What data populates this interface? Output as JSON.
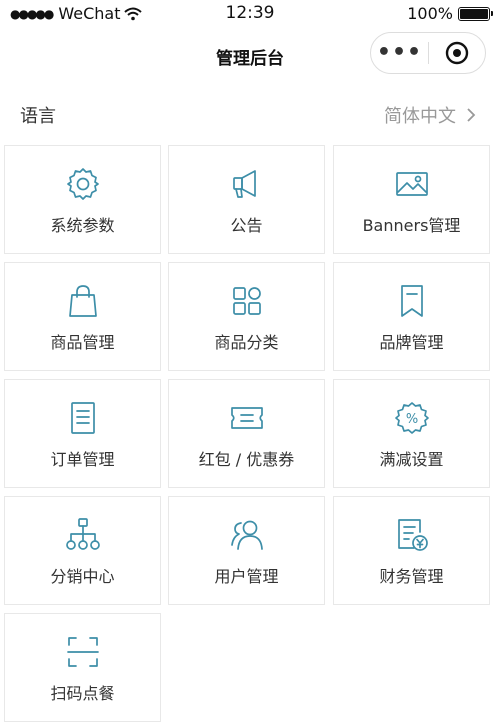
{
  "status_bar": {
    "carrier": "WeChat",
    "time": "12:39",
    "battery": "100%"
  },
  "nav": {
    "title": "管理后台",
    "more_icon": "more-dots-icon",
    "close_icon": "target-close-icon"
  },
  "language": {
    "label": "语言",
    "value": "简体中文"
  },
  "colors": {
    "accent": "#3d8ea8",
    "text": "#333333",
    "muted": "#999999",
    "border": "#e8e8e8"
  },
  "menu": {
    "items": [
      {
        "label": "系统参数",
        "icon": "gear-icon"
      },
      {
        "label": "公告",
        "icon": "megaphone-icon"
      },
      {
        "label": "Banners管理",
        "icon": "image-icon"
      },
      {
        "label": "商品管理",
        "icon": "shopping-bag-icon"
      },
      {
        "label": "商品分类",
        "icon": "category-grid-icon"
      },
      {
        "label": "品牌管理",
        "icon": "bookmark-icon"
      },
      {
        "label": "订单管理",
        "icon": "document-list-icon"
      },
      {
        "label": "红包 / 优惠券",
        "icon": "coupon-icon"
      },
      {
        "label": "满减设置",
        "icon": "percent-badge-icon"
      },
      {
        "label": "分销中心",
        "icon": "hierarchy-icon"
      },
      {
        "label": "用户管理",
        "icon": "users-icon"
      },
      {
        "label": "财务管理",
        "icon": "finance-document-icon"
      },
      {
        "label": "扫码点餐",
        "icon": "scan-icon"
      }
    ]
  }
}
